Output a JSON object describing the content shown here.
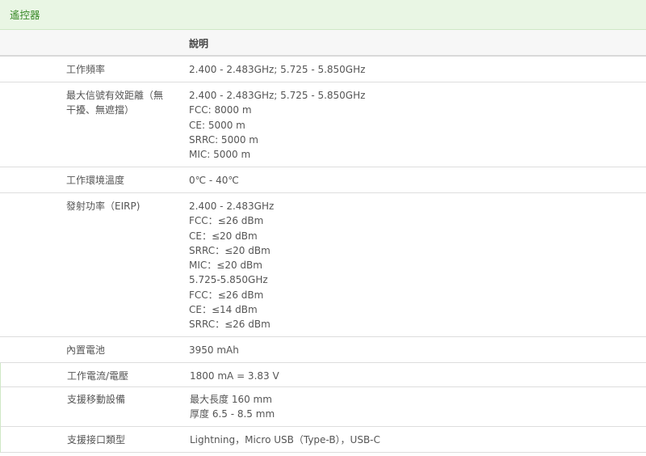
{
  "section": {
    "title": "遙控器"
  },
  "table": {
    "header": "說明",
    "rows": [
      {
        "label": [
          "工作頻率"
        ],
        "values": [
          "2.400 - 2.483GHz; 5.725 - 5.850GHz"
        ]
      },
      {
        "label": [
          "最大信號有效距離（無",
          "干擾、無遮擋）"
        ],
        "values": [
          "2.400 - 2.483GHz; 5.725 - 5.850GHz",
          "FCC: 8000 m",
          "CE: 5000 m",
          "SRRC: 5000 m",
          "MIC: 5000 m"
        ]
      },
      {
        "label": [
          "工作環境溫度"
        ],
        "values": [
          "0℃ - 40℃"
        ]
      },
      {
        "label": [
          "發射功率（EIRP)"
        ],
        "values": [
          "2.400 - 2.483GHz",
          "FCC：≤26 dBm",
          "CE：≤20 dBm",
          "SRRC：≤20 dBm",
          "MIC：≤20 dBm",
          "5.725-5.850GHz",
          "FCC：≤26 dBm",
          "CE：≤14 dBm",
          "SRRC：≤26 dBm"
        ]
      },
      {
        "label": [
          "內置電池"
        ],
        "values": [
          "3950 mAh"
        ]
      },
      {
        "label": [
          "工作電流/電壓"
        ],
        "values": [
          "1800 mA = 3.83 V"
        ]
      },
      {
        "label": [
          "支援移動設備"
        ],
        "values": [
          "最大長度 160 mm",
          "厚度 6.5 - 8.5 mm"
        ]
      },
      {
        "label": [
          "支援接口類型"
        ],
        "values": [
          "Lightning，Micro USB（Type-B），USB-C"
        ]
      }
    ]
  }
}
